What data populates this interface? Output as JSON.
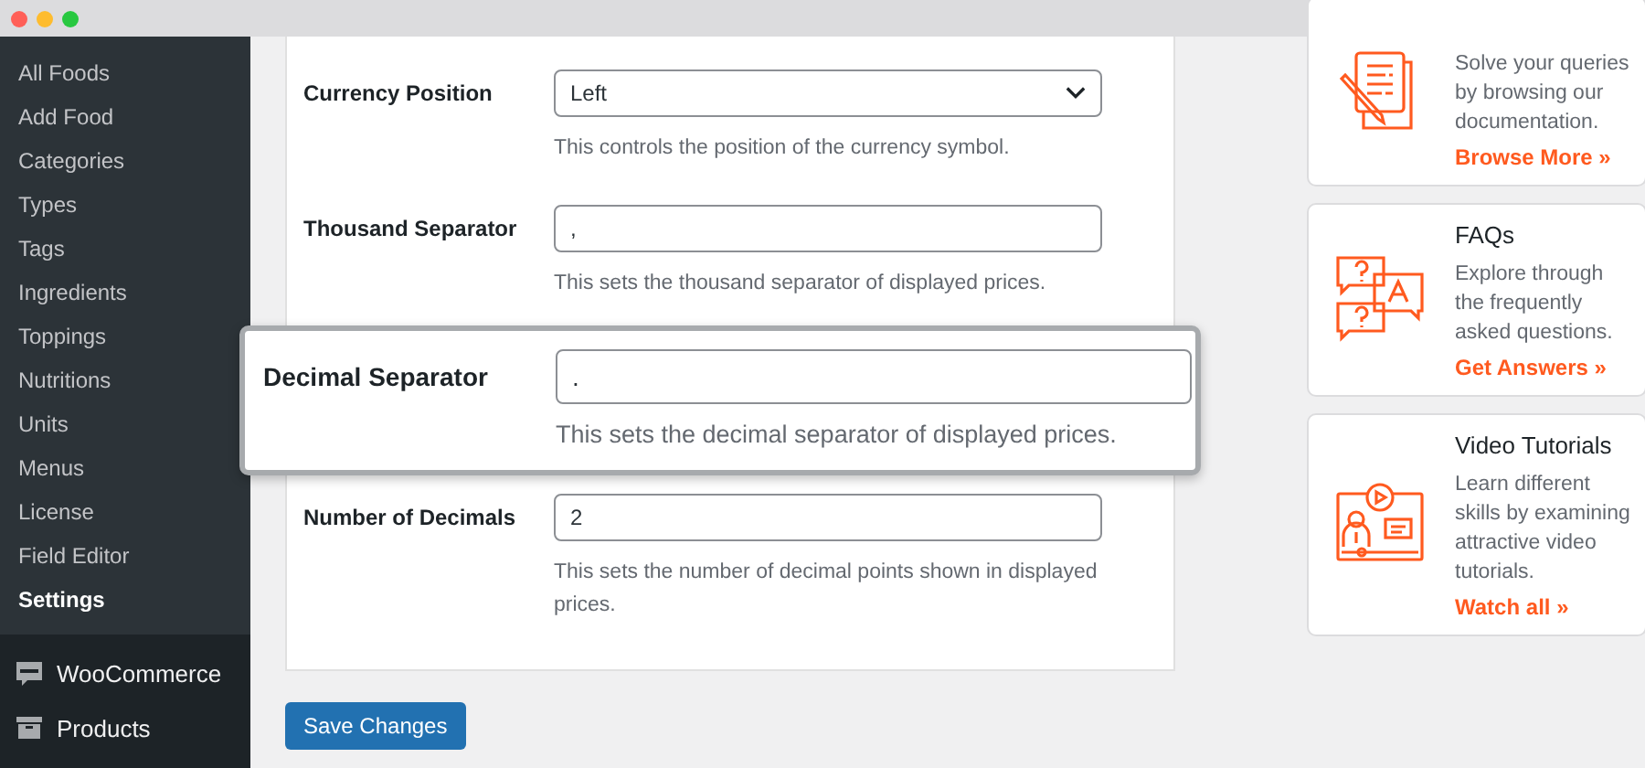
{
  "sidebar": {
    "items": [
      {
        "label": "All Foods",
        "selected": false
      },
      {
        "label": "Add Food",
        "selected": false
      },
      {
        "label": "Categories",
        "selected": false
      },
      {
        "label": "Types",
        "selected": false
      },
      {
        "label": "Tags",
        "selected": false
      },
      {
        "label": "Ingredients",
        "selected": false
      },
      {
        "label": "Toppings",
        "selected": false
      },
      {
        "label": "Nutritions",
        "selected": false
      },
      {
        "label": "Units",
        "selected": false
      },
      {
        "label": "Menus",
        "selected": false
      },
      {
        "label": "License",
        "selected": false
      },
      {
        "label": "Field Editor",
        "selected": false
      },
      {
        "label": "Settings",
        "selected": true
      }
    ],
    "menu": [
      {
        "label": "WooCommerce"
      },
      {
        "label": "Products"
      }
    ]
  },
  "settings": {
    "fields": [
      {
        "kind": "select",
        "label": "Currency Position",
        "value": "Left",
        "hint": "This controls the position of the currency symbol.",
        "highlighted": false
      },
      {
        "kind": "text",
        "label": "Thousand Separator",
        "value": ",",
        "hint": "This sets the thousand separator of displayed prices.",
        "highlighted": false
      },
      {
        "kind": "text",
        "label": "Decimal Separator",
        "value": ".",
        "hint": "This sets the decimal separator of displayed prices.",
        "highlighted": true
      },
      {
        "kind": "text",
        "label": "Number of Decimals",
        "value": "2",
        "hint": "This sets the number of decimal points shown in displayed prices.",
        "highlighted": false
      }
    ],
    "save_button": "Save Changes"
  },
  "help_cards": [
    {
      "text": "Solve your queries by browsing our documentation.",
      "link": "Browse More »"
    },
    {
      "title": "FAQs",
      "text": "Explore through the frequently asked questions.",
      "link": "Get Answers »"
    },
    {
      "title": "Video Tutorials",
      "text": "Learn different skills by examining attractive video tutorials.",
      "link": "Watch all »"
    }
  ]
}
